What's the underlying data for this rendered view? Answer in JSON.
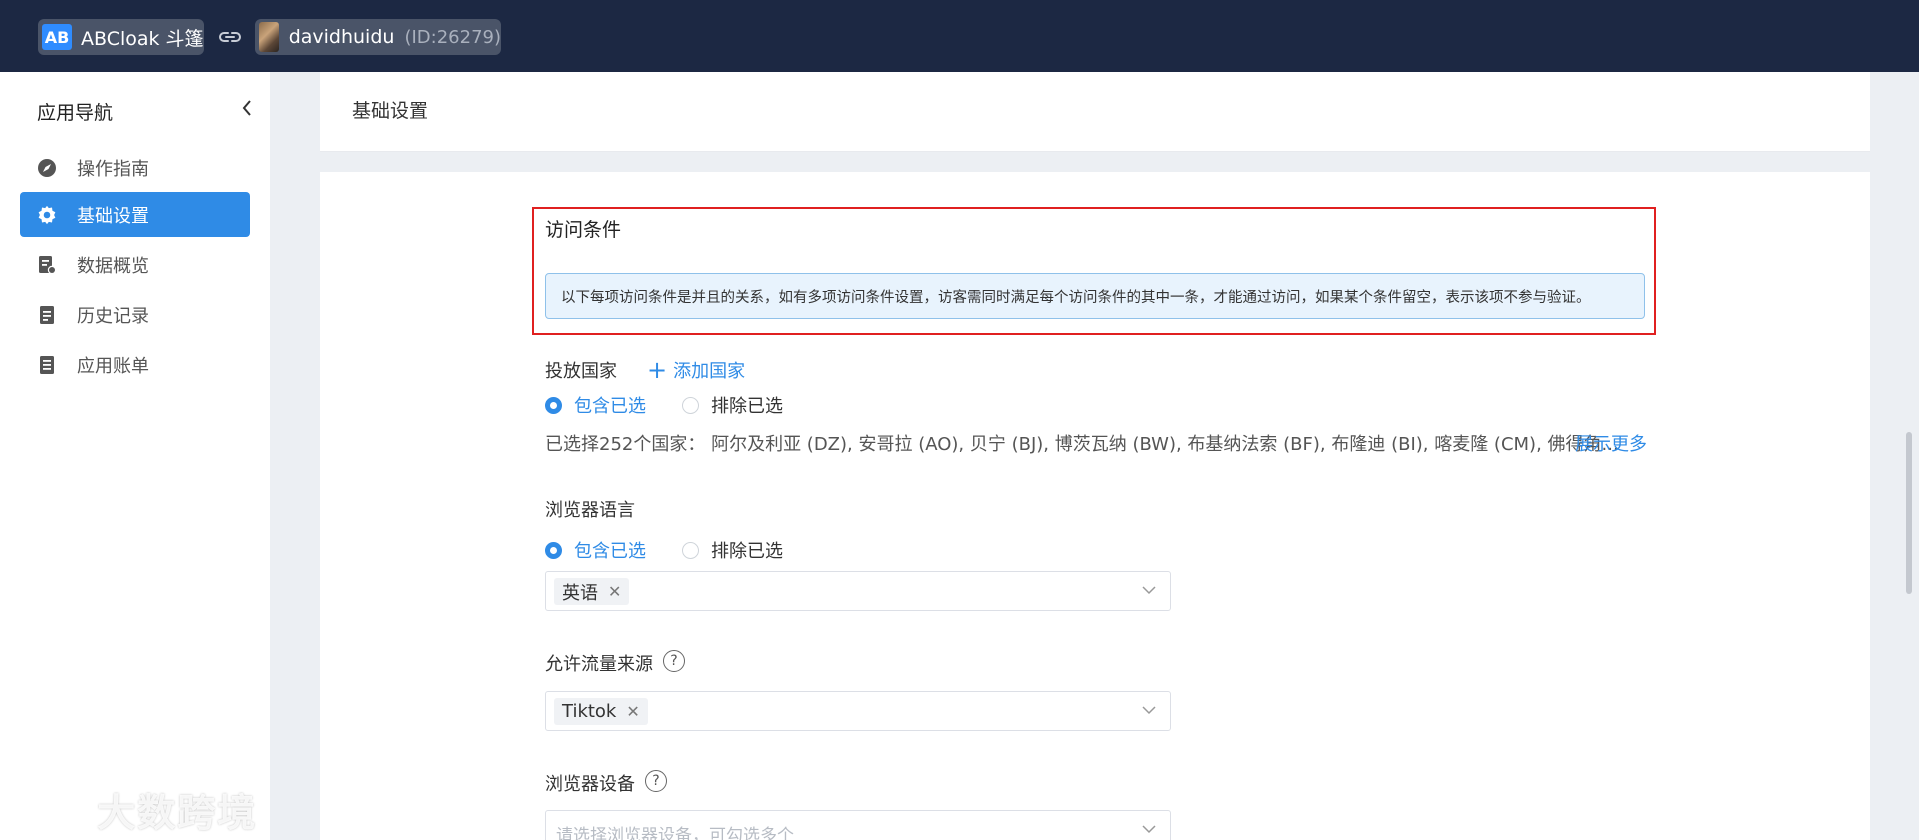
{
  "header": {
    "app_logo": "AB",
    "app_name": "ABCloak 斗篷",
    "user_name": "davidhuidu",
    "user_id": "(ID:26279)"
  },
  "sidebar": {
    "title": "应用导航",
    "items": [
      {
        "label": "操作指南",
        "icon": "navigation-icon",
        "active": false
      },
      {
        "label": "基础设置",
        "icon": "gear-icon",
        "active": true
      },
      {
        "label": "数据概览",
        "icon": "data-report-icon",
        "active": false
      },
      {
        "label": "历史记录",
        "icon": "history-document-icon",
        "active": false
      },
      {
        "label": "应用账单",
        "icon": "bill-document-icon",
        "active": false
      }
    ],
    "watermark": "大数跨境"
  },
  "panel": {
    "title": "基础设置"
  },
  "access_conditions": {
    "title": "访问条件",
    "notice": "以下每项访问条件是并且的关系，如有多项访问条件设置，访客需同时满足每个访问条件的其中一条，才能通过访问，如果某个条件留空，表示该项不参与验证。"
  },
  "country": {
    "label": "投放国家",
    "add_label": "添加国家",
    "include_label": "包含已选",
    "exclude_label": "排除已选",
    "selected_summary": "已选择252个国家： 阿尔及利亚 (DZ), 安哥拉 (AO), 贝宁 (BJ), 博茨瓦纳 (BW), 布基纳法索 (BF), 布隆迪 (BI), 喀麦隆 (CM), 佛得角...",
    "show_more": "展示更多"
  },
  "browser_language": {
    "label": "浏览器语言",
    "include_label": "包含已选",
    "exclude_label": "排除已选",
    "tags": [
      "英语"
    ]
  },
  "traffic_source": {
    "label": "允许流量来源",
    "help": "?",
    "tags": [
      "Tiktok"
    ]
  },
  "browser_device": {
    "label": "浏览器设备",
    "help": "?",
    "placeholder": "请选择浏览器设备，可勾选多个"
  },
  "colors": {
    "topbar": "#1c2843",
    "accent": "#2f8be6",
    "highlight": "#e02020"
  }
}
